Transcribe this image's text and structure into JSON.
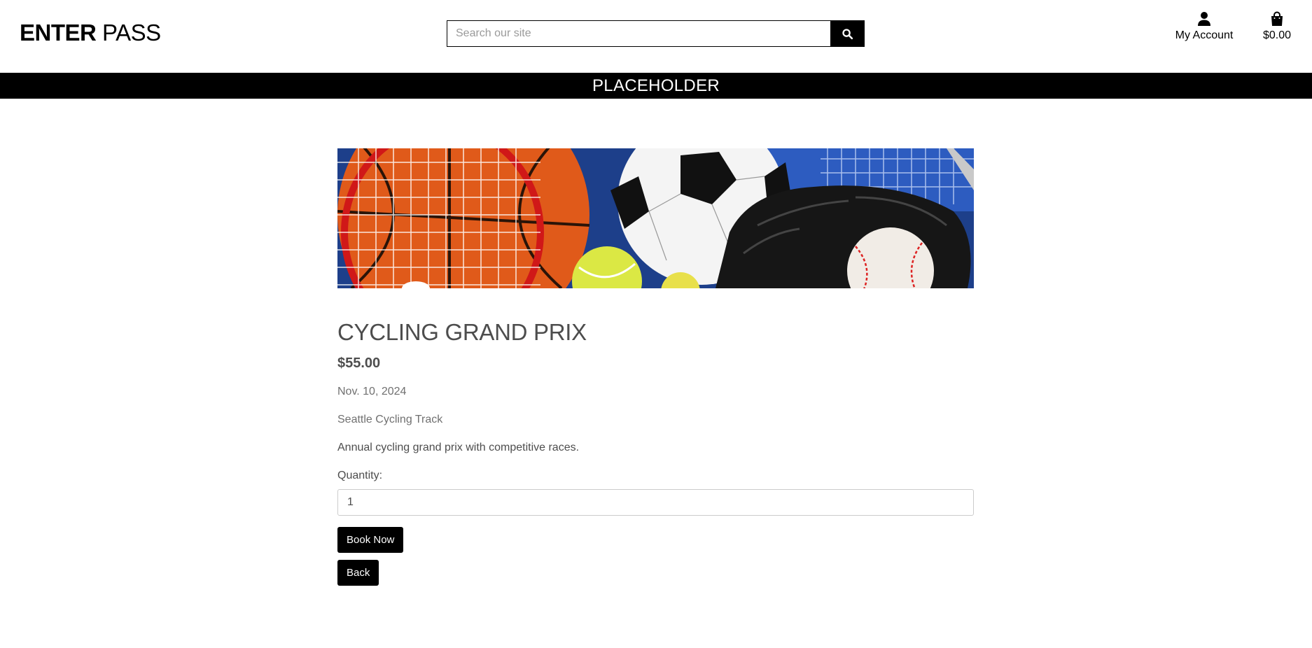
{
  "header": {
    "logo_bold": "ENTER",
    "logo_light": " PASS",
    "search_placeholder": "Search our site",
    "account_label": "My Account",
    "bag_total": "$0.00"
  },
  "banner": {
    "text": "PLACEHOLDER"
  },
  "event": {
    "title": "CYCLING GRAND PRIX",
    "price": "$55.00",
    "date": "Nov. 10, 2024",
    "venue": "Seattle Cycling Track",
    "description": "Annual cycling grand prix with competitive races.",
    "quantity_label": "Quantity:",
    "quantity_value": "1",
    "book_label": "Book Now",
    "back_label": "Back"
  },
  "icons": {
    "search": "search-icon",
    "account": "user-icon",
    "bag": "shopping-bag-icon"
  },
  "colors": {
    "primary": "#000000",
    "text": "#4d4d4d",
    "muted": "#707070"
  }
}
